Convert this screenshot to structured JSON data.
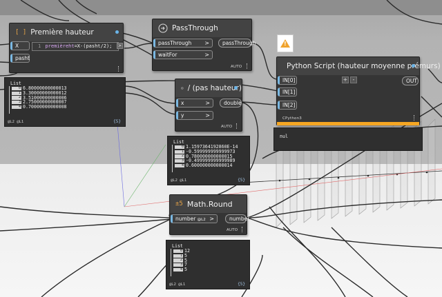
{
  "nodes": {
    "premiere_hauteur": {
      "icon": "[ ]",
      "title": "Première hauteur",
      "inputs": [
        "X",
        "pasht"
      ],
      "code_line_no": "1",
      "code_lhs": "premièreht",
      "code_rhs": "=X-(pasht/2);",
      "expand": ">"
    },
    "passthrough": {
      "icon": "pass-through-icon",
      "title": "PassThrough",
      "inputs": [
        "passThrough",
        "waitFor"
      ],
      "output": "passThrough",
      "lacing": "AUTO"
    },
    "python": {
      "title": "Python Script (hauteur moyenne prémurs)",
      "inputs": [
        "IN[0]",
        "IN[1]",
        "IN[2]"
      ],
      "output": "OUT",
      "add": "+",
      "remove": "-",
      "engine": "CPython3",
      "preview": "nul"
    },
    "division": {
      "icon": "+",
      "title": "/ (pas hauteur)",
      "inputs": [
        "x",
        "y"
      ],
      "output": "double",
      "lacing": "AUTO"
    },
    "round": {
      "icon": "±5",
      "title": "Math.Round",
      "input": "number",
      "input_level": "@L2",
      "output": "number",
      "lacing": "AUTO"
    }
  },
  "previews": {
    "premiere_hauteur": {
      "label": "List",
      "rows": [
        {
          "i": "0",
          "v": "6.80000000000013"
        },
        {
          "i": "1",
          "v": "3.30000000000012"
        },
        {
          "i": "2",
          "v": "3.51000000000006"
        },
        {
          "i": "3",
          "v": "2.75000000000007"
        },
        {
          "i": "4",
          "v": "0.70000000000008"
        }
      ],
      "footer": "@L2 @L1",
      "count": "{5}"
    },
    "division": {
      "label": "List",
      "rows": [
        {
          "i": "0",
          "v": "1.1597364192860E-14"
        },
        {
          "i": "1",
          "v": "-0.599999999999973"
        },
        {
          "i": "2",
          "v": "0.780000000000015"
        },
        {
          "i": "3",
          "v": "-0.499999999999989"
        },
        {
          "i": "4",
          "v": "0.600000000000014"
        }
      ],
      "footer": "@L2 @L1",
      "count": "{5}"
    },
    "round": {
      "label": "List",
      "rows": [
        {
          "i": "0",
          "v": "12"
        },
        {
          "i": "1",
          "v": "5"
        },
        {
          "i": "2",
          "v": "5"
        },
        {
          "i": "3",
          "v": "7"
        },
        {
          "i": "4",
          "v": "5"
        }
      ],
      "footer": "@L2 @L1",
      "count": "{5}"
    }
  },
  "warning": {
    "symbol": "!"
  },
  "colors": {
    "node_body": "#353535",
    "node_header": "#434343",
    "port_accent": "#7ab8e2",
    "python_bar": "#f5a623",
    "warning": "#f0a32d",
    "wire": "#2a2a2a"
  }
}
